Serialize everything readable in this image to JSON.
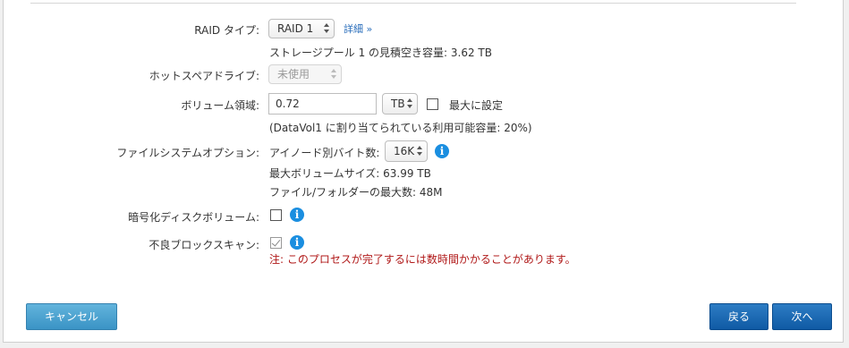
{
  "raid": {
    "label": "RAID タイプ:",
    "value": "RAID 1",
    "detail_link": "詳細 »",
    "capacity_note": "ストレージプール 1 の見積空き容量: 3.62 TB"
  },
  "hotspare": {
    "label": "ホットスペアドライブ:",
    "value": "未使用"
  },
  "volume": {
    "label": "ボリューム領域:",
    "size_value": "0.72",
    "unit_value": "TB",
    "max_label": "最大に設定",
    "max_checked": false,
    "note": "(DataVol1 に割り当てられている利用可能容量: 20%)"
  },
  "filesystem": {
    "label": "ファイルシステムオプション:",
    "inode_label": "アイノード別バイト数:",
    "inode_value": "16K",
    "max_volume_size": "最大ボリュームサイズ: 63.99 TB",
    "max_files": "ファイル/フォルダーの最大数: 48M"
  },
  "encryption": {
    "label": "暗号化ディスクボリューム:",
    "checked": false
  },
  "badblock": {
    "label": "不良ブロックスキャン:",
    "checked": true,
    "warning": "注: このプロセスが完了するには数時間かかることがあります。"
  },
  "buttons": {
    "cancel": "キャンセル",
    "back": "戻る",
    "next": "次へ"
  },
  "icons": {
    "info": "i"
  },
  "colors": {
    "link": "#2a6ebb",
    "info_icon": "#1a8ee0",
    "warning_text": "#b01818",
    "cancel_button": "#4aa3d2",
    "primary_button": "#1565b4"
  }
}
